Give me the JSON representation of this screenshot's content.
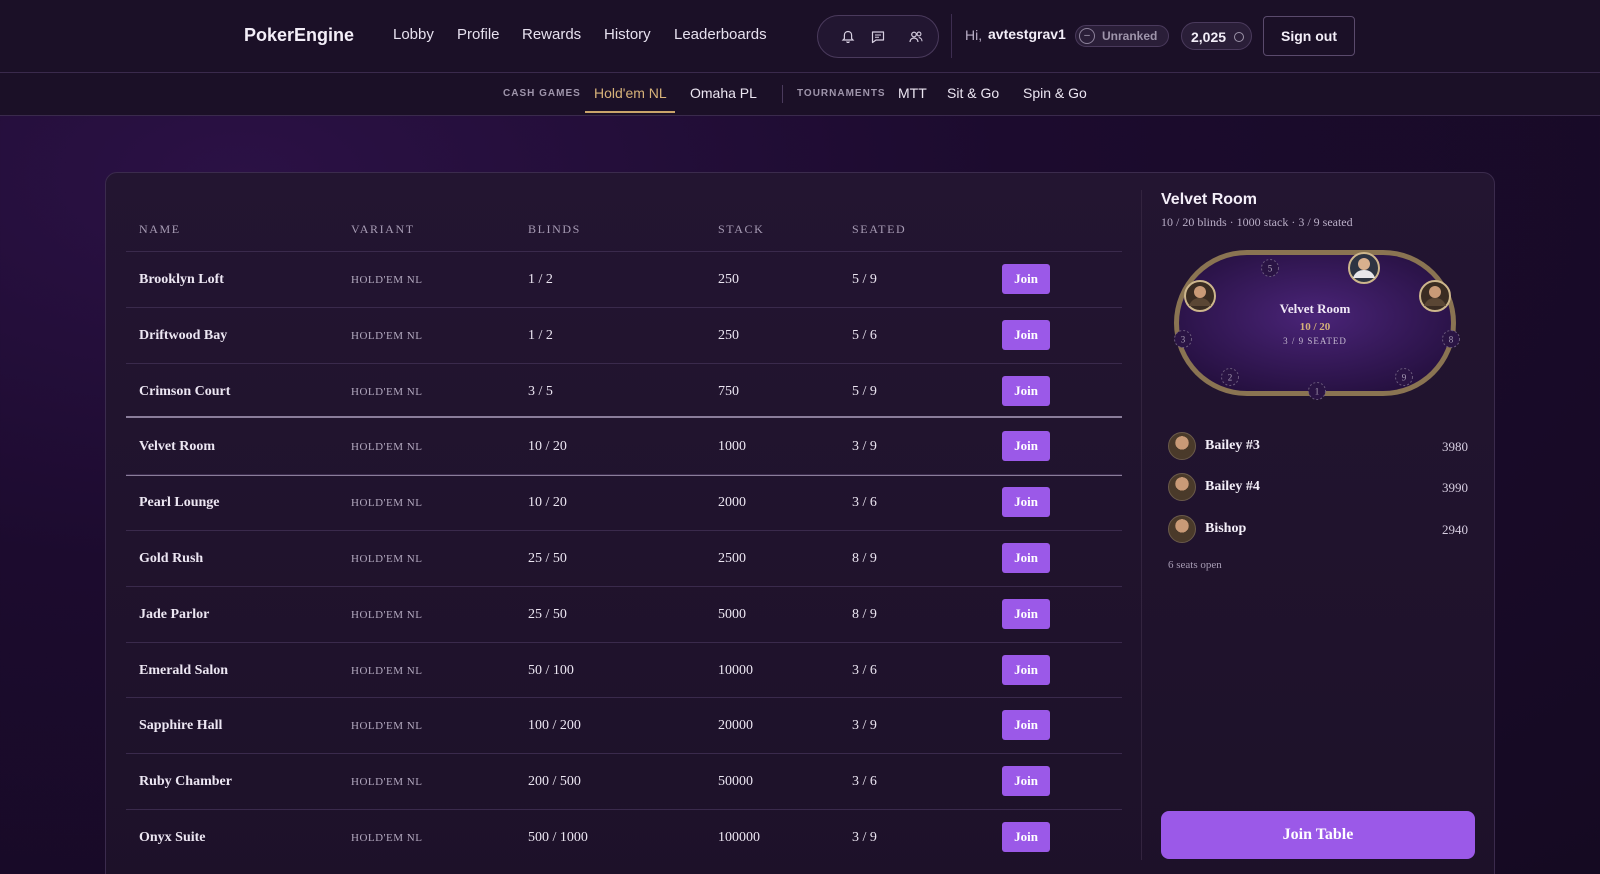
{
  "header": {
    "brand": "PokerEngine",
    "nav": [
      "Lobby",
      "Profile",
      "Rewards",
      "History",
      "Leaderboards"
    ],
    "greeting": "Hi,",
    "username": "avtestgrav1",
    "rank_symbol": "–",
    "rank": "Unranked",
    "balance": "2,025",
    "sign_out": "Sign out",
    "icons": [
      "bell-icon",
      "chat-icon",
      "friends-icon",
      "chip-icon"
    ]
  },
  "subnav": {
    "cash_label": "CASH GAMES",
    "cash_tabs": [
      "Hold'em NL",
      "Omaha PL"
    ],
    "tourn_label": "TOURNAMENTS",
    "tourn_tabs": [
      "MTT",
      "Sit & Go",
      "Spin & Go"
    ],
    "active_tab": "Hold'em NL"
  },
  "table": {
    "headers": [
      "NAME",
      "VARIANT",
      "BLINDS",
      "STACK",
      "SEATED"
    ],
    "join_label": "Join",
    "selected_index": 3,
    "rows": [
      {
        "name": "Brooklyn Loft",
        "variant": "HOLD'EM NL",
        "blinds": "1 / 2",
        "stack": "250",
        "seated": "5 / 9"
      },
      {
        "name": "Driftwood Bay",
        "variant": "HOLD'EM NL",
        "blinds": "1 / 2",
        "stack": "250",
        "seated": "5 / 6"
      },
      {
        "name": "Crimson Court",
        "variant": "HOLD'EM NL",
        "blinds": "3 / 5",
        "stack": "750",
        "seated": "5 / 9"
      },
      {
        "name": "Velvet Room",
        "variant": "HOLD'EM NL",
        "blinds": "10 / 20",
        "stack": "1000",
        "seated": "3 / 9"
      },
      {
        "name": "Pearl Lounge",
        "variant": "HOLD'EM NL",
        "blinds": "10 / 20",
        "stack": "2000",
        "seated": "3 / 6"
      },
      {
        "name": "Gold Rush",
        "variant": "HOLD'EM NL",
        "blinds": "25 / 50",
        "stack": "2500",
        "seated": "8 / 9"
      },
      {
        "name": "Jade Parlor",
        "variant": "HOLD'EM NL",
        "blinds": "25 / 50",
        "stack": "5000",
        "seated": "8 / 9"
      },
      {
        "name": "Emerald Salon",
        "variant": "HOLD'EM NL",
        "blinds": "50 / 100",
        "stack": "10000",
        "seated": "3 / 6"
      },
      {
        "name": "Sapphire Hall",
        "variant": "HOLD'EM NL",
        "blinds": "100 / 200",
        "stack": "20000",
        "seated": "3 / 9"
      },
      {
        "name": "Ruby Chamber",
        "variant": "HOLD'EM NL",
        "blinds": "200 / 500",
        "stack": "50000",
        "seated": "3 / 6"
      },
      {
        "name": "Onyx Suite",
        "variant": "HOLD'EM NL",
        "blinds": "500 / 1000",
        "stack": "100000",
        "seated": "3 / 9"
      }
    ]
  },
  "detail": {
    "title": "Velvet Room",
    "subtitle": "10 / 20 blinds · 1000 stack · 3 / 9 seated",
    "felt_name": "Velvet Room",
    "felt_blinds": "10 / 20",
    "felt_seated": "3 / 9 SEATED",
    "empty_seats": [
      "5",
      "3",
      "8",
      "2",
      "1",
      "9"
    ],
    "players": [
      {
        "name": "Bailey #3",
        "chips": "3980"
      },
      {
        "name": "Bailey #4",
        "chips": "3990"
      },
      {
        "name": "Bishop",
        "chips": "2940"
      }
    ],
    "seats_open": "6 seats open",
    "join_table": "Join Table"
  },
  "colors": {
    "accent": "#9b59e8",
    "gold": "#c9a46a",
    "felt": "#3a1c5e"
  }
}
